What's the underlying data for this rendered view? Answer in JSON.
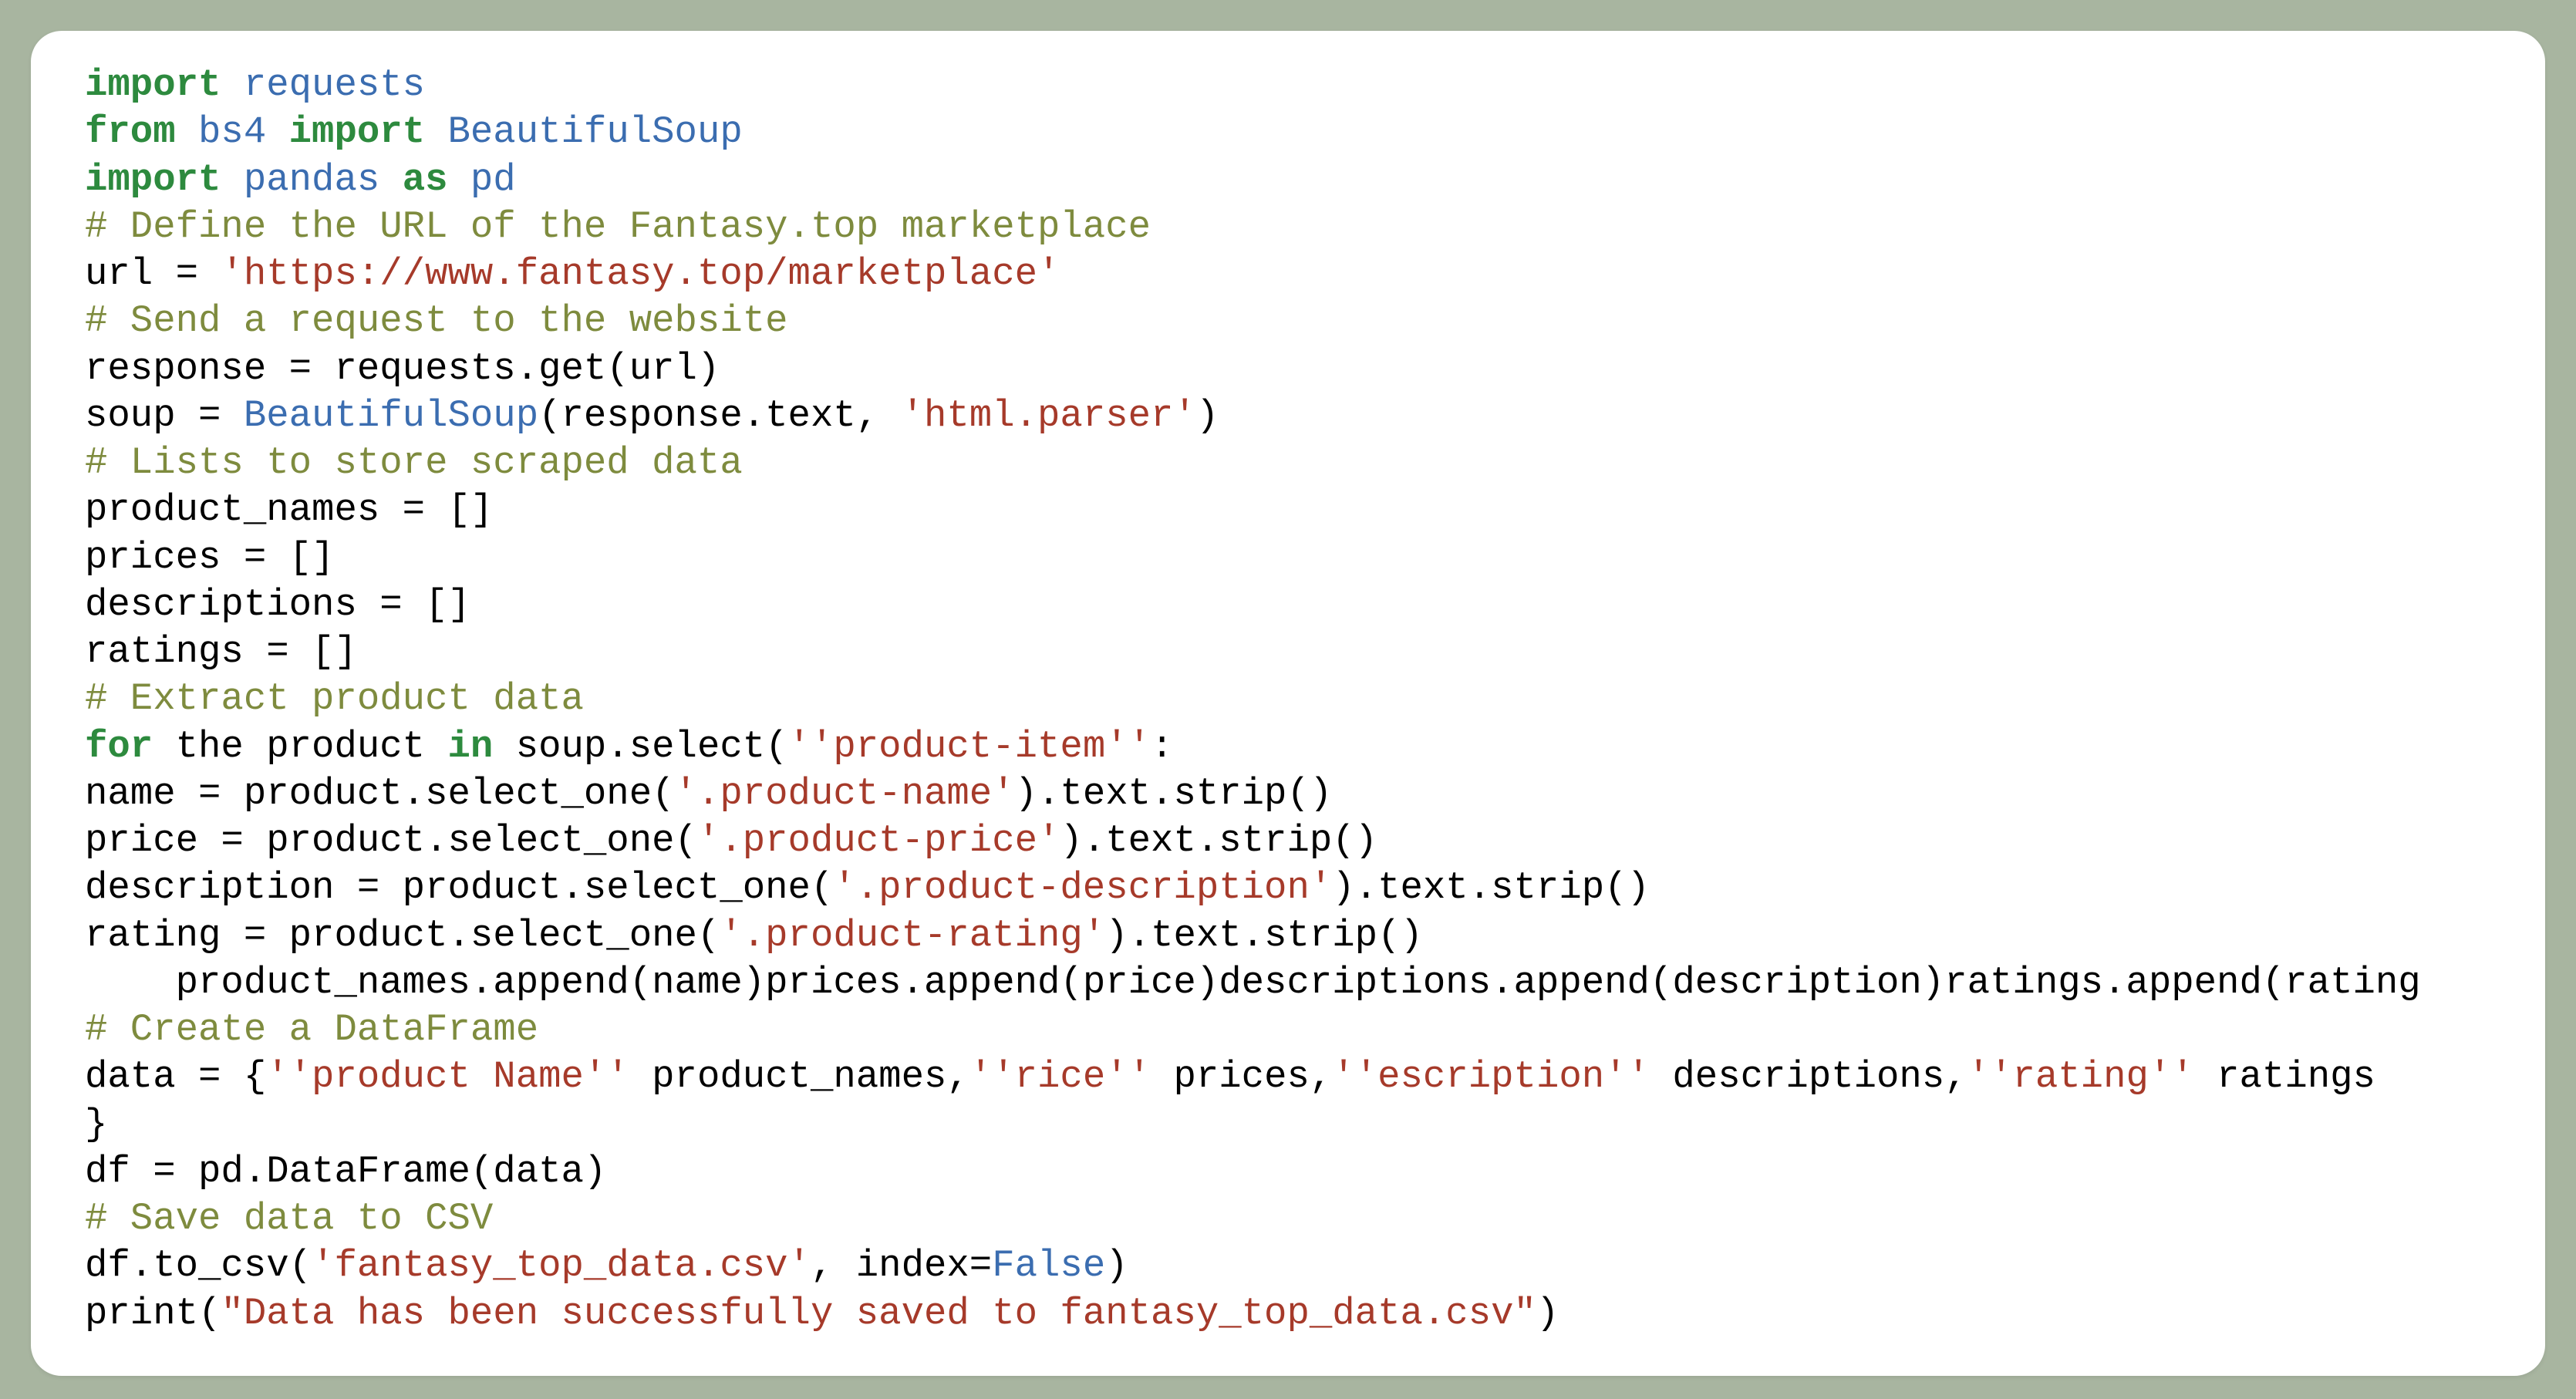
{
  "code": {
    "l1": {
      "kw1": "import",
      "sp": " ",
      "mod": "requests"
    },
    "l2": {
      "kw1": "from",
      "sp": " ",
      "mod1": "bs4",
      "sp2": " ",
      "kw2": "import",
      "sp3": " ",
      "mod2": "BeautifulSoup"
    },
    "l3": {
      "kw1": "import",
      "sp": " ",
      "mod1": "pandas",
      "sp2": " ",
      "kw2": "as",
      "sp3": " ",
      "mod2": "pd"
    },
    "l4": {
      "comm": "# Define the URL of the Fantasy.top marketplace"
    },
    "l5": {
      "pre": "url = ",
      "str": "'https://www.fantasy.top/marketplace'"
    },
    "l6": {
      "comm": "# Send a request to the website"
    },
    "l7": {
      "txt": "response = requests.get(url)"
    },
    "l8": {
      "pre": "soup = ",
      "mod": "BeautifulSoup",
      "mid": "(response.text, ",
      "str": "'html.parser'",
      "post": ")"
    },
    "l9": {
      "comm": "# Lists to store scraped data"
    },
    "l10": {
      "txt": "product_names = []"
    },
    "l11": {
      "txt": "prices = []"
    },
    "l12": {
      "txt": "descriptions = []"
    },
    "l13": {
      "txt": "ratings = []"
    },
    "l14": {
      "comm": "# Extract product data"
    },
    "l15": {
      "kw1": "for",
      "mid1": " the product ",
      "kw2": "in",
      "mid2": " soup.select(",
      "str": "''product-item''",
      "post": ":"
    },
    "l16": {
      "pre": "name = product.select_one(",
      "str": "'.product-name'",
      "post": ").text.strip()"
    },
    "l17": {
      "pre": "price = product.select_one(",
      "str": "'.product-price'",
      "post": ").text.strip()"
    },
    "l18": {
      "pre": "description = product.select_one(",
      "str": "'.product-description'",
      "post": ").text.strip()"
    },
    "l19": {
      "pre": "rating = product.select_one(",
      "str": "'.product-rating'",
      "post": ").text.strip()"
    },
    "l20": {
      "indent": "    ",
      "txt": "product_names.append(name)prices.append(price)descriptions.append(description)ratings.append(rating"
    },
    "l21": {
      "comm": "# Create a DataFrame"
    },
    "l22": {
      "pre": "data = {",
      "s1": "''product Name''",
      "m1": " product_names,",
      "s2": "''rice''",
      "m2": " prices,",
      "s3": "''escription''",
      "m3": " descriptions,",
      "s4": "''rating''",
      "m4": " ratings"
    },
    "l23": {
      "txt": "}"
    },
    "l24": {
      "txt": "df = pd.DataFrame(data)"
    },
    "l25": {
      "comm": "# Save data to CSV"
    },
    "l26": {
      "pre": "df.to_csv(",
      "str": "'fantasy_top_data.csv'",
      "mid": ", index=",
      "mod": "False",
      "post": ")"
    },
    "l27": {
      "pre": "print(",
      "str": "\"Data has been successfully saved to fantasy_top_data.csv\"",
      "post": ")"
    }
  }
}
